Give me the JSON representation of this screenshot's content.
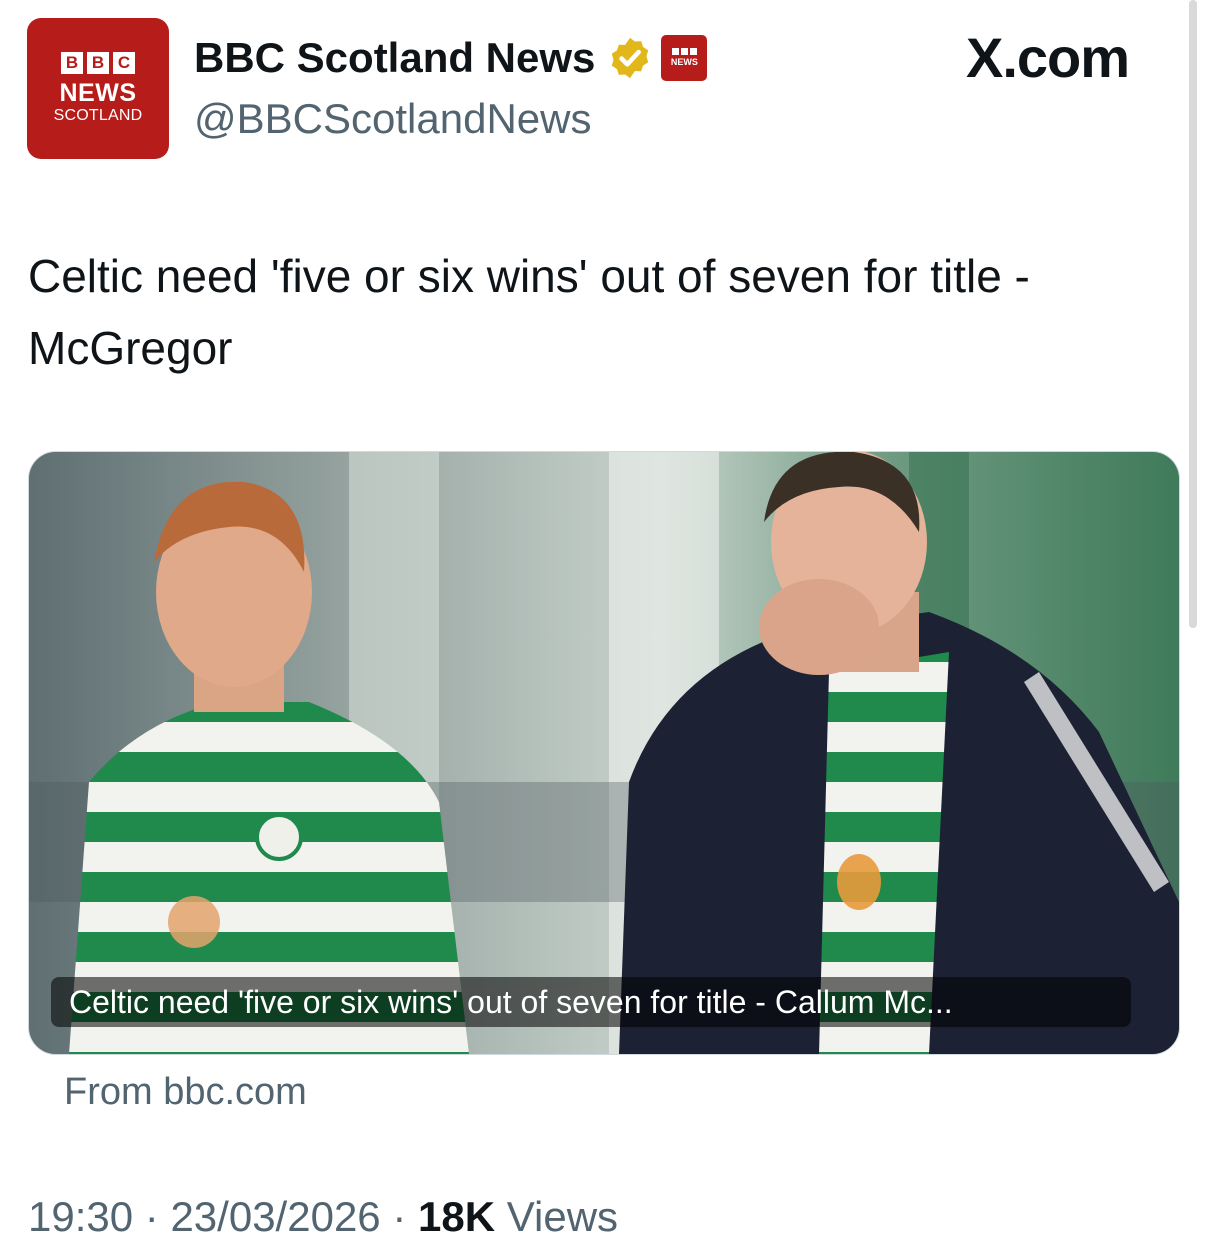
{
  "account": {
    "avatar_blocks": [
      "B",
      "B",
      "C"
    ],
    "avatar_news": "NEWS",
    "avatar_region": "SCOTLAND",
    "display_name": "BBC Scotland News",
    "handle": "@BBCScotlandNews",
    "verified_icon": "gold-verified-badge-icon",
    "affiliate_badge_text": "NEWS"
  },
  "site_label": "X.com",
  "tweet": {
    "text": "Celtic need 'five or six wins' out of seven for title - McGregor"
  },
  "card": {
    "caption": "Celtic need 'five or six wins' out of seven for title - Callum Mc...",
    "source": "From bbc.com"
  },
  "meta": {
    "time": "19:30",
    "separator": "·",
    "date": "23/03/2026",
    "views_count": "18K",
    "views_label": "Views"
  },
  "colors": {
    "bbc_red": "#b61c1a",
    "verified_gold": "#e2b719",
    "secondary_text": "#536471",
    "primary_text": "#0f1419",
    "celtic_green": "#1f8a4c"
  }
}
